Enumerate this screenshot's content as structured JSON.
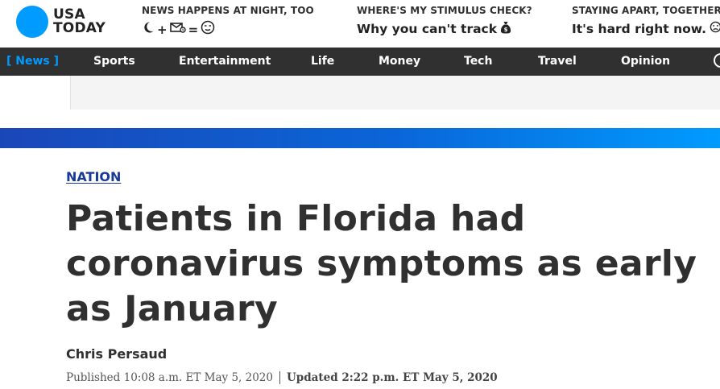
{
  "brand": {
    "line1": "USA",
    "line2": "TODAY",
    "color": "#009bff"
  },
  "promos": [
    {
      "kicker": "NEWS HAPPENS AT NIGHT, TOO",
      "icons": [
        "moon-icon",
        "plus",
        "email-icon",
        "equals",
        "wink-face-icon"
      ],
      "plus": "+",
      "equals": "="
    },
    {
      "kicker": "WHERE'S MY STIMULUS CHECK?",
      "title": "Why you can't track",
      "icon": "money-bag-icon"
    },
    {
      "kicker": "STAYING APART, TOGETHER",
      "title": "It's hard right now.",
      "icon": "sad-face-icon"
    }
  ],
  "nav": {
    "items": [
      "[ News ]",
      "Sports",
      "Entertainment",
      "Life",
      "Money",
      "Tech",
      "Travel",
      "Opinion"
    ],
    "active_index": 0,
    "active_color": "#009bff"
  },
  "article": {
    "section": "NATION",
    "headline": "Patients in Florida had coronavirus symptoms as early as January",
    "byline": "Chris Persaud",
    "published": "Published 10:08 a.m. ET May 5, 2020",
    "updated": "Updated 2:22 p.m. ET May 5, 2020"
  }
}
